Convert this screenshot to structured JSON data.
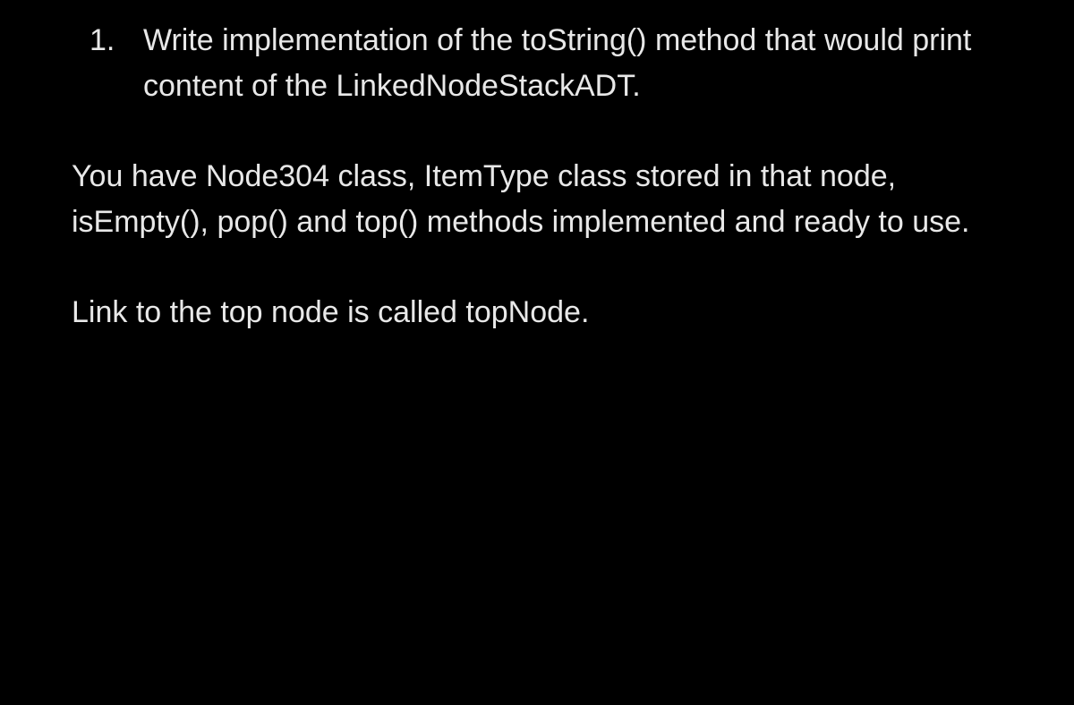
{
  "question": {
    "number": "1.",
    "text": "Write implementation of the toString() method that would print content of the LinkedNodeStackADT."
  },
  "paragraphs": [
    "You have Node304 class, ItemType class stored in that node, isEmpty(), pop() and top() methods implemented and ready to use.",
    "Link to the top node is called topNode."
  ]
}
